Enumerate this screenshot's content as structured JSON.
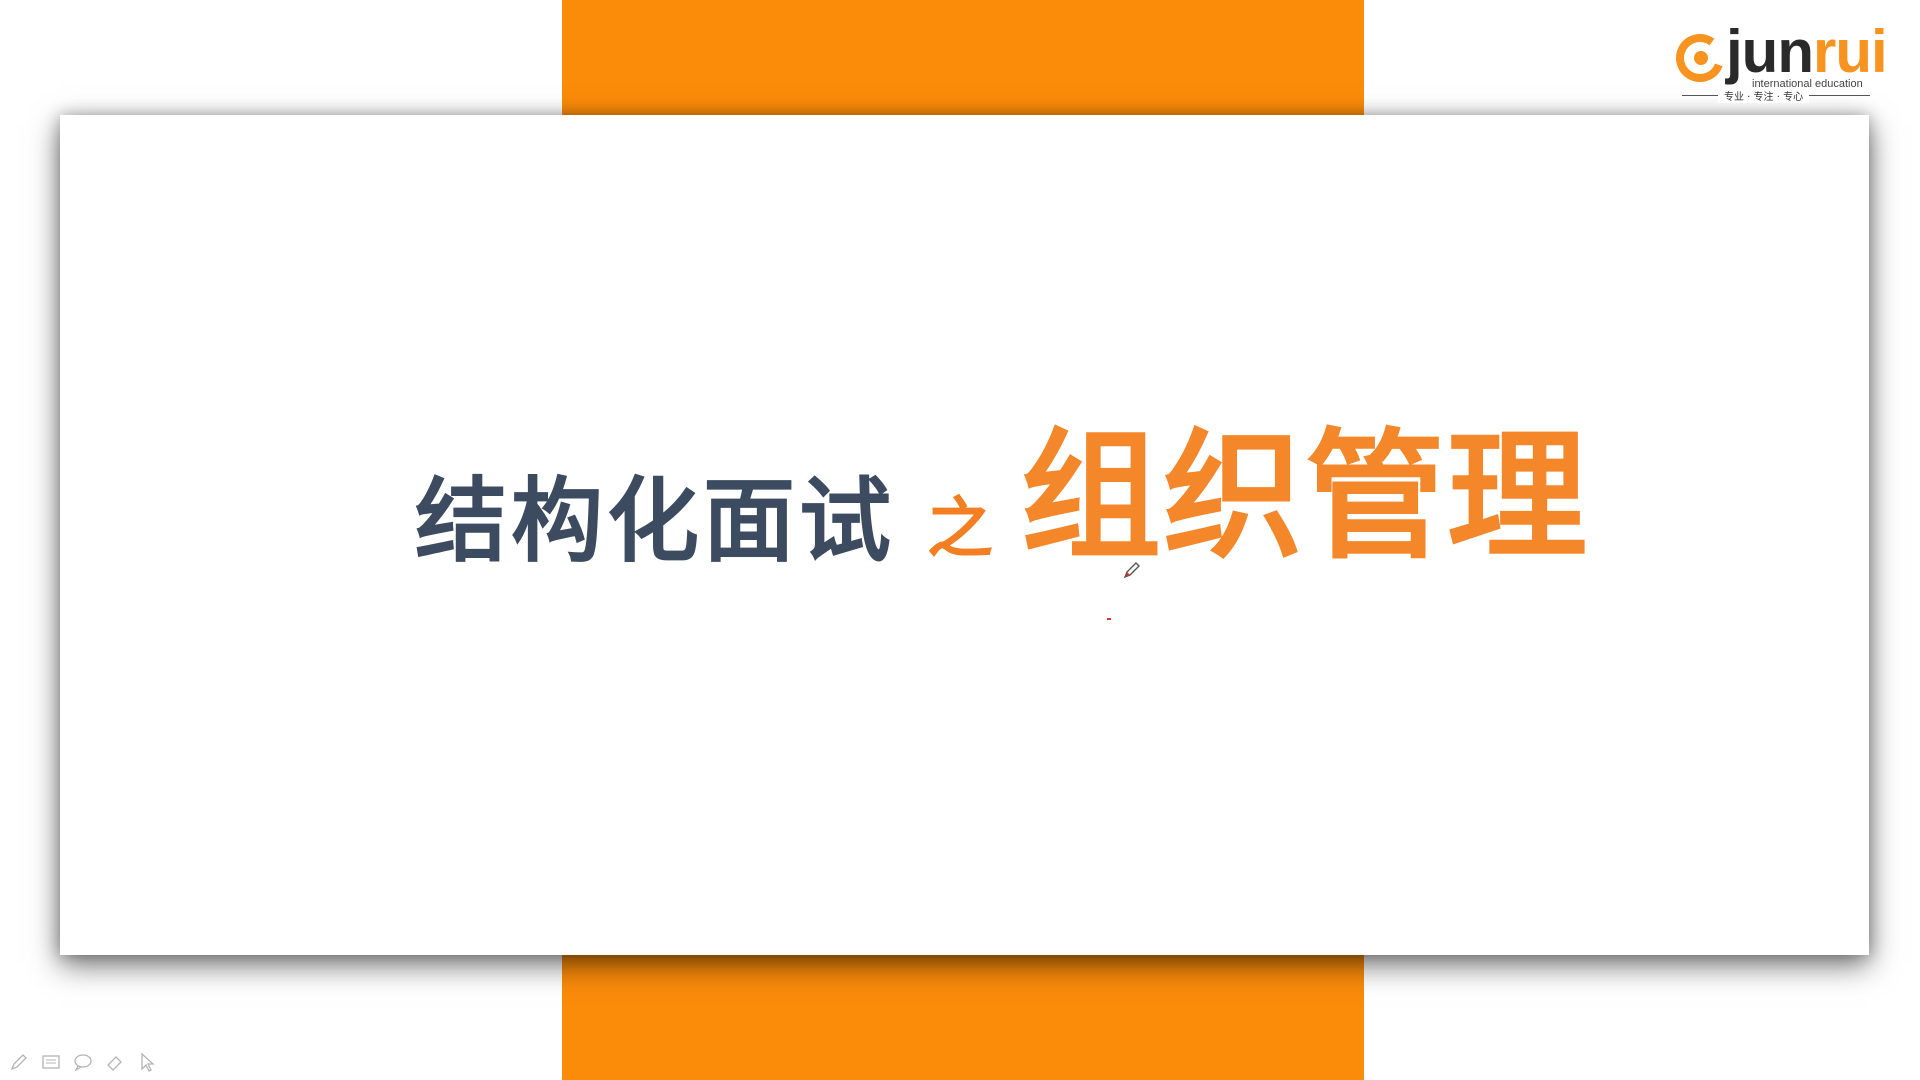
{
  "slide": {
    "title_main": "结构化面试",
    "title_connector": "之",
    "title_sub": "组织管理"
  },
  "logo": {
    "word_dark": "jun",
    "word_orange": "rui",
    "tagline": "international education",
    "motto": "专业 · 专注 · 专心"
  },
  "toolbar": {
    "items": [
      "pen-icon",
      "slides-icon",
      "chat-bubble-icon",
      "eraser-icon",
      "pointer-icon"
    ]
  },
  "colors": {
    "accent": "#fb8c0a",
    "title_dark": "#3d4b60",
    "title_orange": "#f5872b"
  }
}
